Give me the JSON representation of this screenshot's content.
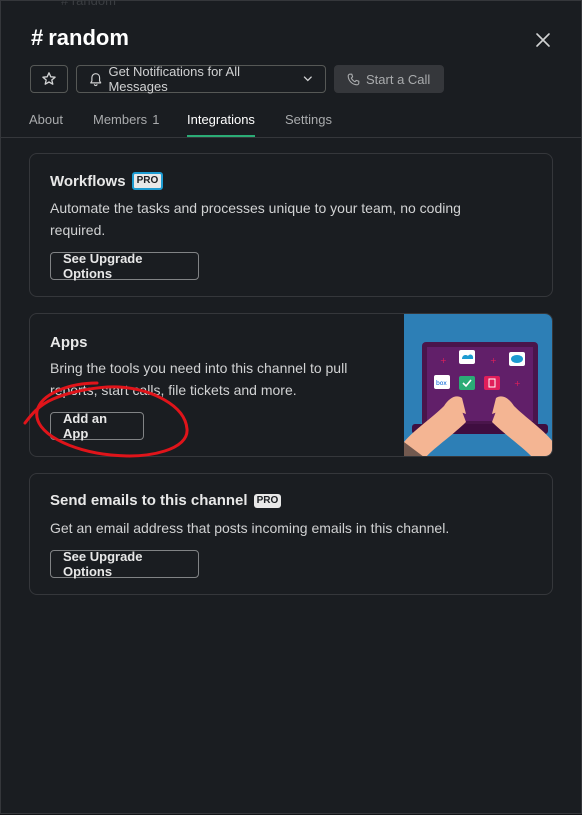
{
  "header": {
    "background_text": "# random",
    "channel_name": "random",
    "star_icon": "star-icon",
    "notifications_label": "Get Notifications for All Messages",
    "call_label": "Start a Call"
  },
  "tabs": [
    {
      "label": "About"
    },
    {
      "label": "Members",
      "count": "1"
    },
    {
      "label": "Integrations",
      "active": true
    },
    {
      "label": "Settings"
    }
  ],
  "workflows": {
    "title": "Workflows",
    "badge": "PRO",
    "description_line1": "Automate the tasks and processes unique to your team, no coding",
    "description_line2": "required.",
    "button": "See Upgrade Options"
  },
  "apps": {
    "title": "Apps",
    "description_line1": "Bring the tools you need into this channel to pull",
    "description_line2": "reports, start calls, file tickets and more.",
    "button": "Add an App",
    "illustration_text": "box"
  },
  "emails": {
    "title": "Send emails to this channel",
    "badge": "PRO",
    "description": "Get an email address that posts incoming emails in this channel.",
    "button": "See Upgrade Options"
  },
  "colors": {
    "background": "#1a1d21",
    "active_tab_underline": "#2bac76",
    "annotation": "#e0141a",
    "pro_badge_border": "#1d9bd1"
  }
}
